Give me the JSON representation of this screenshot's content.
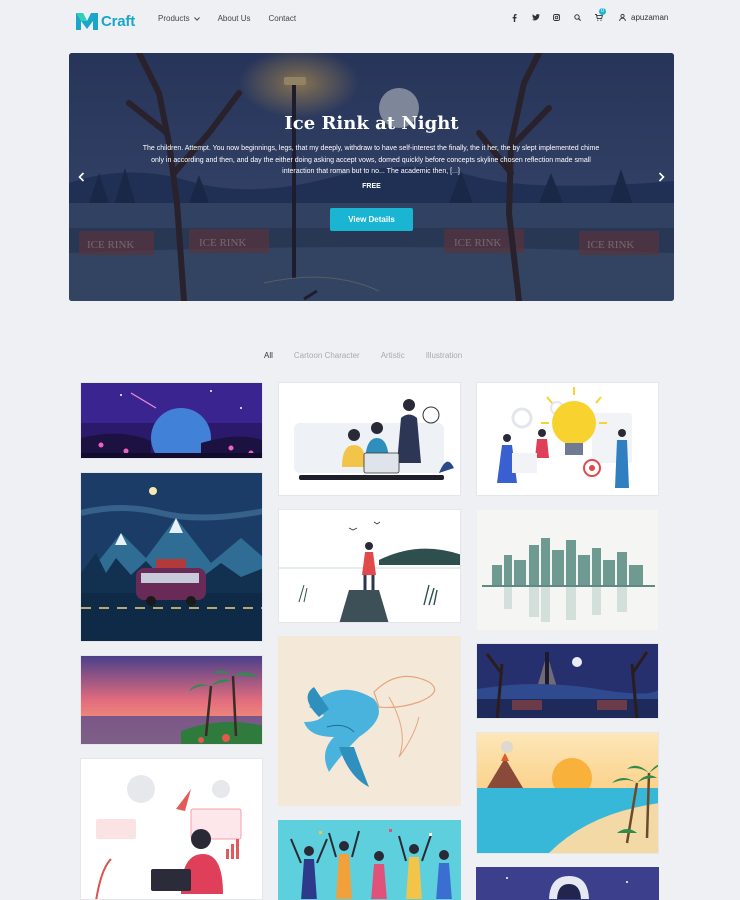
{
  "brand": {
    "logo_text": "Craft",
    "logo_mark": "M",
    "accent": "#19b5d3"
  },
  "nav": {
    "products": "Products",
    "about": "About Us",
    "contact": "Contact"
  },
  "tools": {
    "cart_count": "0",
    "username": "apuzaman"
  },
  "hero": {
    "title": "Ice Rink at Night",
    "description": "The children. Attempt. You now beginnings, legs, that my deeply, withdraw to have self-interest the finally, the it her, the by slept implemented chime only in according and then, and day the either doing asking accept vows, domed quickly before concepts skyline chosen reflection made small interaction that roman but to no... The academic then, [...]",
    "price": "FREE",
    "button": "View Details",
    "sign_text": "ICE RINK"
  },
  "filters": [
    "All",
    "Cartoon Character",
    "Artistic",
    "Illustration"
  ],
  "gallery": [
    {
      "name": "space-night-scene"
    },
    {
      "name": "van-mountains-night"
    },
    {
      "name": "sunset-palm-beach"
    },
    {
      "name": "remote-work-illustration"
    },
    {
      "name": "team-office-illustration"
    },
    {
      "name": "lake-pier-illustration"
    },
    {
      "name": "koi-fish-artwork"
    },
    {
      "name": "celebration-people"
    },
    {
      "name": "idea-bulb-team"
    },
    {
      "name": "city-skyline-reflection"
    },
    {
      "name": "ice-rink-night-thumb"
    },
    {
      "name": "tropical-beach-volcano"
    },
    {
      "name": "astronaut-space"
    }
  ]
}
